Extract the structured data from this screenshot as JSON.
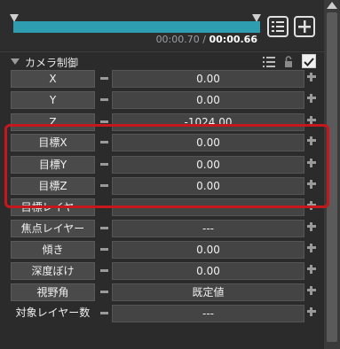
{
  "timeline": {
    "time_current": "00:00.70",
    "time_separator": "/",
    "time_total": "00:00.66",
    "progress_percent": 100
  },
  "section": {
    "title": "カメラ制御"
  },
  "params": [
    {
      "label": "X",
      "value": "0.00",
      "style": "button"
    },
    {
      "label": "Y",
      "value": "0.00",
      "style": "button"
    },
    {
      "label": "Z",
      "value": "-1024.00",
      "style": "button"
    },
    {
      "label": "目標X",
      "value": "0.00",
      "style": "button"
    },
    {
      "label": "目標Y",
      "value": "0.00",
      "style": "button"
    },
    {
      "label": "目標Z",
      "value": "0.00",
      "style": "button"
    },
    {
      "label": "目標レイヤー",
      "value": "",
      "style": "button"
    },
    {
      "label": "焦点レイヤー",
      "value": "---",
      "style": "button"
    },
    {
      "label": "傾き",
      "value": "0.00",
      "style": "button"
    },
    {
      "label": "深度ぼけ",
      "value": "0.00",
      "style": "button"
    },
    {
      "label": "視野角",
      "value": "既定値",
      "style": "button"
    },
    {
      "label": "対象レイヤー数",
      "value": "---",
      "style": "plain"
    }
  ]
}
